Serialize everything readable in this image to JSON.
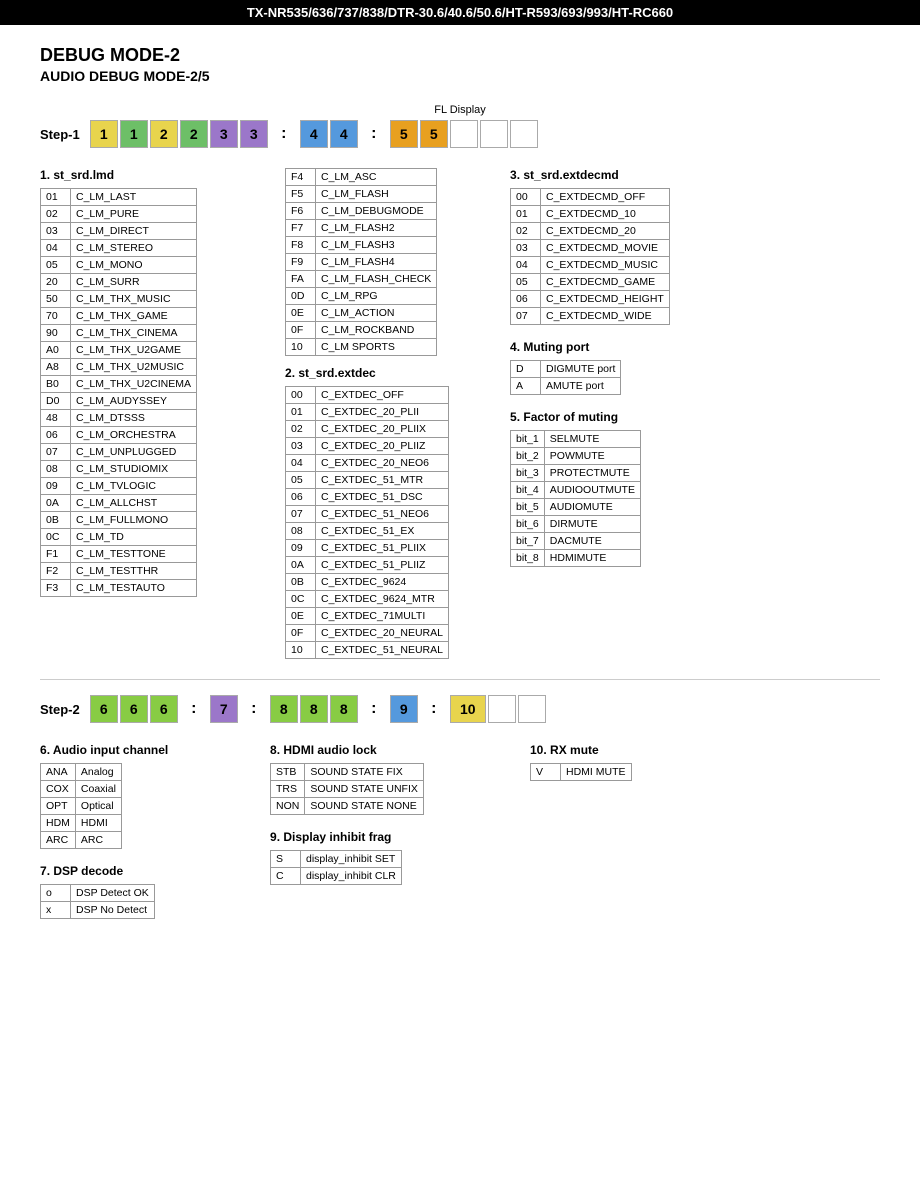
{
  "header": {
    "title": "TX-NR535/636/737/838/DTR-30.6/40.6/50.6/HT-R593/693/993/HT-RC660"
  },
  "page": {
    "title": "DEBUG MODE-2",
    "subtitle": "AUDIO DEBUG MODE-2/5"
  },
  "fl_display_label": "FL Display",
  "step1": {
    "label": "Step-1",
    "cells": [
      {
        "value": "1",
        "color": "yellow"
      },
      {
        "value": "1",
        "color": "green"
      },
      {
        "value": "2",
        "color": "yellow"
      },
      {
        "value": "2",
        "color": "green"
      },
      {
        "value": "3",
        "color": "purple"
      },
      {
        "value": "3",
        "color": "purple"
      },
      {
        "value": ":",
        "color": "colon"
      },
      {
        "value": "4",
        "color": "blue"
      },
      {
        "value": "4",
        "color": "blue"
      },
      {
        "value": ":",
        "color": "colon"
      },
      {
        "value": "5",
        "color": "orange"
      },
      {
        "value": "5",
        "color": "orange"
      },
      {
        "value": "",
        "color": "empty"
      },
      {
        "value": "",
        "color": "empty"
      },
      {
        "value": "",
        "color": "empty"
      }
    ]
  },
  "step2": {
    "label": "Step-2",
    "cells": [
      {
        "value": "6",
        "color": "bright-green"
      },
      {
        "value": "6",
        "color": "bright-green"
      },
      {
        "value": "6",
        "color": "bright-green"
      },
      {
        "value": ":",
        "color": "colon"
      },
      {
        "value": "7",
        "color": "purple"
      },
      {
        "value": ":",
        "color": "colon"
      },
      {
        "value": "8",
        "color": "bright-green"
      },
      {
        "value": "8",
        "color": "bright-green"
      },
      {
        "value": "8",
        "color": "bright-green"
      },
      {
        "value": ":",
        "color": "colon"
      },
      {
        "value": "9",
        "color": "blue"
      },
      {
        "value": ":",
        "color": "colon"
      },
      {
        "value": "10",
        "color": "yellow"
      },
      {
        "value": "",
        "color": "empty"
      },
      {
        "value": "",
        "color": "empty"
      }
    ]
  },
  "section1": {
    "number": "1",
    "title": "st_srd.lmd",
    "rows": [
      {
        "code": "01",
        "value": "C_LM_LAST"
      },
      {
        "code": "02",
        "value": "C_LM_PURE"
      },
      {
        "code": "03",
        "value": "C_LM_DIRECT"
      },
      {
        "code": "04",
        "value": "C_LM_STEREO"
      },
      {
        "code": "05",
        "value": "C_LM_MONO"
      },
      {
        "code": "20",
        "value": "C_LM_SURR"
      },
      {
        "code": "50",
        "value": "C_LM_THX_MUSIC"
      },
      {
        "code": "70",
        "value": "C_LM_THX_GAME"
      },
      {
        "code": "90",
        "value": "C_LM_THX_CINEMA"
      },
      {
        "code": "A0",
        "value": "C_LM_THX_U2GAME"
      },
      {
        "code": "A8",
        "value": "C_LM_THX_U2MUSIC"
      },
      {
        "code": "B0",
        "value": "C_LM_THX_U2CINEMA"
      },
      {
        "code": "D0",
        "value": "C_LM_AUDYSSEY"
      },
      {
        "code": "48",
        "value": "C_LM_DTSSS"
      },
      {
        "code": "06",
        "value": "C_LM_ORCHESTRA"
      },
      {
        "code": "07",
        "value": "C_LM_UNPLUGGED"
      },
      {
        "code": "08",
        "value": "C_LM_STUDIOMIX"
      },
      {
        "code": "09",
        "value": "C_LM_TVLOGIC"
      },
      {
        "code": "0A",
        "value": "C_LM_ALLCHST"
      },
      {
        "code": "0B",
        "value": "C_LM_FULLMONO"
      },
      {
        "code": "0C",
        "value": "C_LM_TD"
      },
      {
        "code": "F1",
        "value": "C_LM_TESTTONE"
      },
      {
        "code": "F2",
        "value": "C_LM_TESTTHR"
      },
      {
        "code": "F3",
        "value": "C_LM_TESTAUTO"
      }
    ]
  },
  "section1b": {
    "rows": [
      {
        "code": "F4",
        "value": "C_LM_ASC"
      },
      {
        "code": "F5",
        "value": "C_LM_FLASH"
      },
      {
        "code": "F6",
        "value": "C_LM_DEBUGMODE"
      },
      {
        "code": "F7",
        "value": "C_LM_FLASH2"
      },
      {
        "code": "F8",
        "value": "C_LM_FLASH3"
      },
      {
        "code": "F9",
        "value": "C_LM_FLASH4"
      },
      {
        "code": "FA",
        "value": "C_LM_FLASH_CHECK"
      },
      {
        "code": "0D",
        "value": "C_LM_RPG"
      },
      {
        "code": "0E",
        "value": "C_LM_ACTION"
      },
      {
        "code": "0F",
        "value": "C_LM_ROCKBAND"
      },
      {
        "code": "10",
        "value": "C_LM  SPORTS"
      }
    ]
  },
  "section2": {
    "number": "2",
    "title": "st_srd.extdec",
    "rows": [
      {
        "code": "00",
        "value": "C_EXTDEC_OFF"
      },
      {
        "code": "01",
        "value": "C_EXTDEC_20_PLII"
      },
      {
        "code": "02",
        "value": "C_EXTDEC_20_PLIIX"
      },
      {
        "code": "03",
        "value": "C_EXTDEC_20_PLIIZ"
      },
      {
        "code": "04",
        "value": "C_EXTDEC_20_NEO6"
      },
      {
        "code": "05",
        "value": "C_EXTDEC_51_MTR"
      },
      {
        "code": "06",
        "value": "C_EXTDEC_51_DSC"
      },
      {
        "code": "07",
        "value": "C_EXTDEC_51_NEO6"
      },
      {
        "code": "08",
        "value": "C_EXTDEC_51_EX"
      },
      {
        "code": "09",
        "value": "C_EXTDEC_51_PLIIX"
      },
      {
        "code": "0A",
        "value": "C_EXTDEC_51_PLIIZ"
      },
      {
        "code": "0B",
        "value": "C_EXTDEC_9624"
      },
      {
        "code": "0C",
        "value": "C_EXTDEC_9624_MTR"
      },
      {
        "code": "0E",
        "value": "C_EXTDEC_71MULTI"
      },
      {
        "code": "0F",
        "value": "C_EXTDEC_20_NEURAL"
      },
      {
        "code": "10",
        "value": "C_EXTDEC_51_NEURAL"
      }
    ]
  },
  "section3": {
    "number": "3",
    "title": "st_srd.extdecmd",
    "rows": [
      {
        "code": "00",
        "value": "C_EXTDECMD_OFF"
      },
      {
        "code": "01",
        "value": "C_EXTDECMD_10"
      },
      {
        "code": "02",
        "value": "C_EXTDECMD_20"
      },
      {
        "code": "03",
        "value": "C_EXTDECMD_MOVIE"
      },
      {
        "code": "04",
        "value": "C_EXTDECMD_MUSIC"
      },
      {
        "code": "05",
        "value": "C_EXTDECMD_GAME"
      },
      {
        "code": "06",
        "value": "C_EXTDECMD_HEIGHT"
      },
      {
        "code": "07",
        "value": "C_EXTDECMD_WIDE"
      }
    ]
  },
  "section4": {
    "number": "4",
    "title": "Muting port",
    "rows": [
      {
        "code": "D",
        "value": "DIGMUTE port"
      },
      {
        "code": "A",
        "value": "AMUTE port"
      }
    ]
  },
  "section5": {
    "number": "5",
    "title": "Factor of muting",
    "rows": [
      {
        "code": "bit_1",
        "value": "SELMUTE"
      },
      {
        "code": "bit_2",
        "value": "POWMUTE"
      },
      {
        "code": "bit_3",
        "value": "PROTECTMUTE"
      },
      {
        "code": "bit_4",
        "value": "AUDIOOUTMUTE"
      },
      {
        "code": "bit_5",
        "value": "AUDIOMUTE"
      },
      {
        "code": "bit_6",
        "value": "DIRMUTE"
      },
      {
        "code": "bit_7",
        "value": "DACMUTE"
      },
      {
        "code": "bit_8",
        "value": "HDMIMUTE"
      }
    ]
  },
  "section6": {
    "number": "6",
    "title": "Audio input channel",
    "rows": [
      {
        "code": "ANA",
        "value": "Analog"
      },
      {
        "code": "COX",
        "value": "Coaxial"
      },
      {
        "code": "OPT",
        "value": "Optical"
      },
      {
        "code": "HDM",
        "value": "HDMI"
      },
      {
        "code": "ARC",
        "value": "ARC"
      }
    ]
  },
  "section7": {
    "number": "7",
    "title": "DSP decode",
    "rows": [
      {
        "code": "o",
        "value": "DSP Detect OK"
      },
      {
        "code": "x",
        "value": "DSP No Detect"
      }
    ]
  },
  "section8": {
    "number": "8",
    "title": "HDMI audio lock",
    "rows": [
      {
        "code": "STB",
        "value": "SOUND STATE FIX"
      },
      {
        "code": "TRS",
        "value": "SOUND STATE UNFIX"
      },
      {
        "code": "NON",
        "value": "SOUND STATE NONE"
      }
    ]
  },
  "section9": {
    "number": "9",
    "title": "Display inhibit frag",
    "rows": [
      {
        "code": "S",
        "value": "display_inhibit SET"
      },
      {
        "code": "C",
        "value": "display_inhibit CLR"
      }
    ]
  },
  "section10": {
    "number": "10",
    "title": "RX mute",
    "rows": [
      {
        "code": "V",
        "value": "HDMI MUTE"
      }
    ]
  }
}
